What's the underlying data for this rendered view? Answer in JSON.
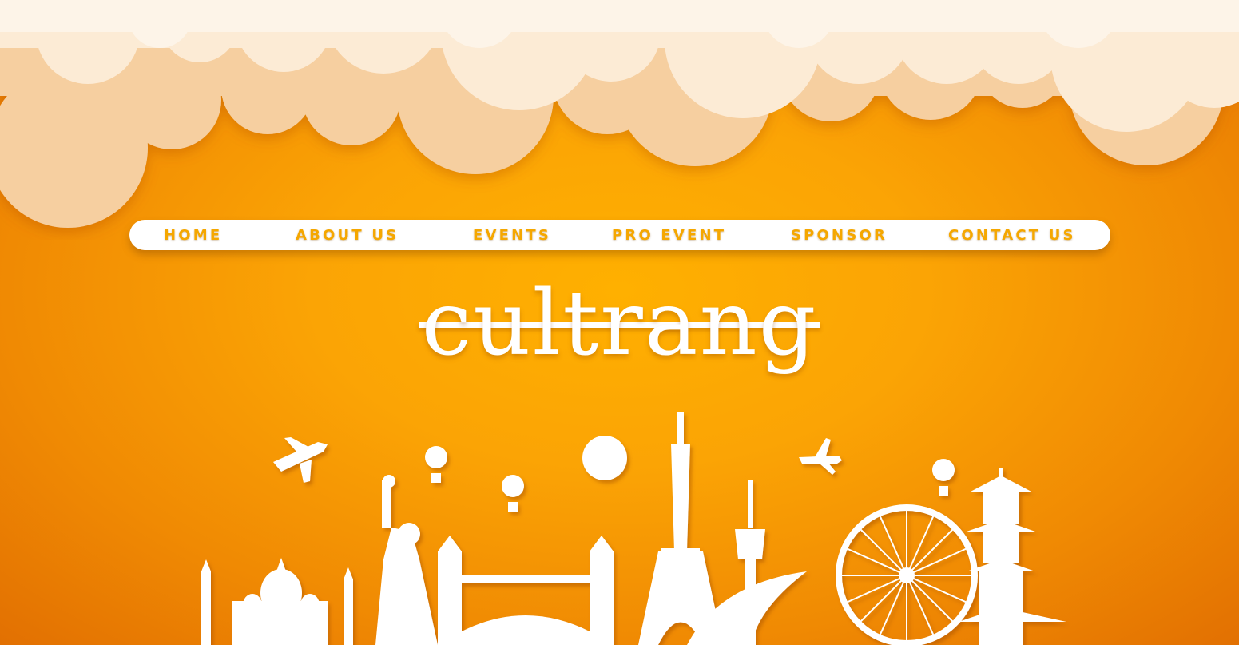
{
  "nav": {
    "items": [
      {
        "label": "HOME"
      },
      {
        "label": "ABOUT US"
      },
      {
        "label": "EVENTS"
      },
      {
        "label": "PRO EVENT"
      },
      {
        "label": "SPONSOR"
      },
      {
        "label": "CONTACT US"
      }
    ]
  },
  "hero": {
    "logo_text": "cultrang"
  },
  "colors": {
    "background": "#fba405",
    "nav_text": "#f5a700",
    "cloud": "#fdf1e0",
    "silhouette": "#ffffff"
  }
}
